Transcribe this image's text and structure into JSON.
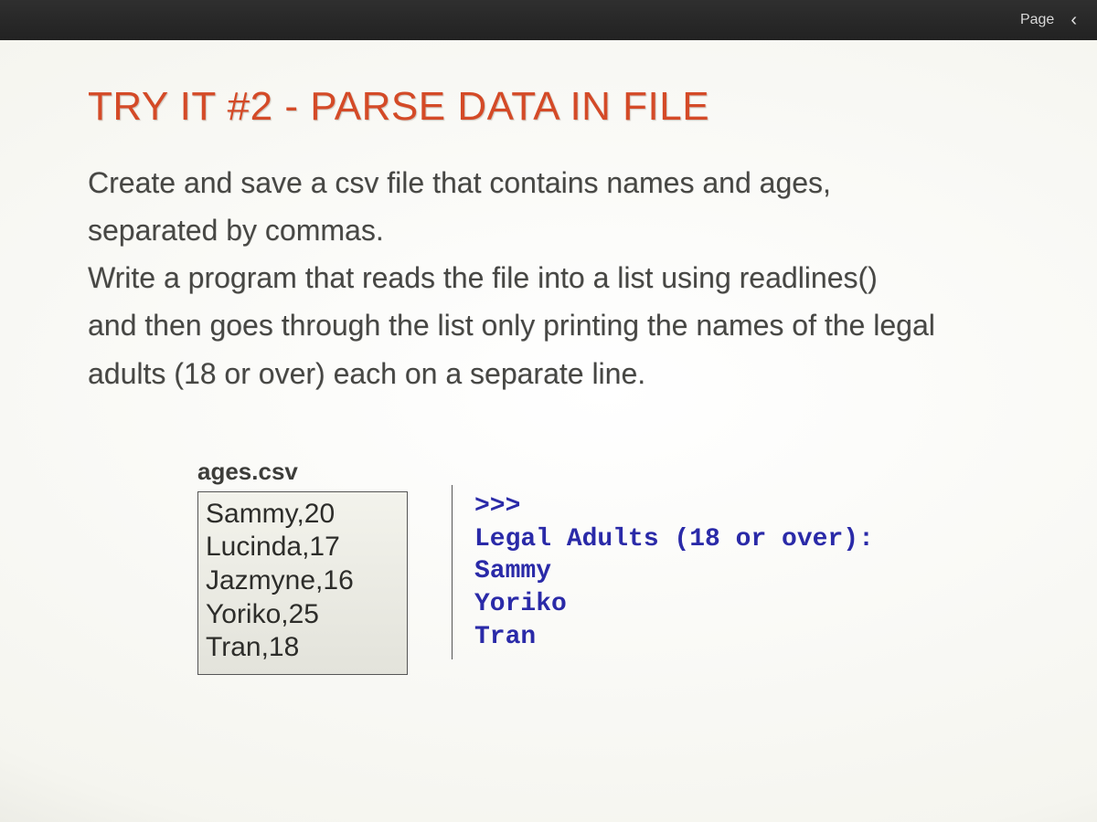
{
  "topbar": {
    "page_label": "Page",
    "prev_icon": "‹"
  },
  "slide": {
    "title": "TRY IT #2 - PARSE DATA IN FILE",
    "para1a": "Create and save a csv file that contains names and ages,",
    "para1b": "separated by commas.",
    "para2": "Write a program that reads the file into a list using readlines()",
    "para3a": "and then goes through the list only printing the names of the legal",
    "para3b": "adults (18 or over) each on a separate line."
  },
  "csv": {
    "filename": "ages.csv",
    "rows": [
      "Sammy,20",
      "Lucinda,17",
      "Jazmyne,16",
      "Yoriko,25",
      "Tran,18"
    ]
  },
  "output": {
    "prompt": ">>>",
    "header": "Legal Adults (18 or over):",
    "names": [
      "Sammy",
      "Yoriko",
      "Tran"
    ]
  }
}
